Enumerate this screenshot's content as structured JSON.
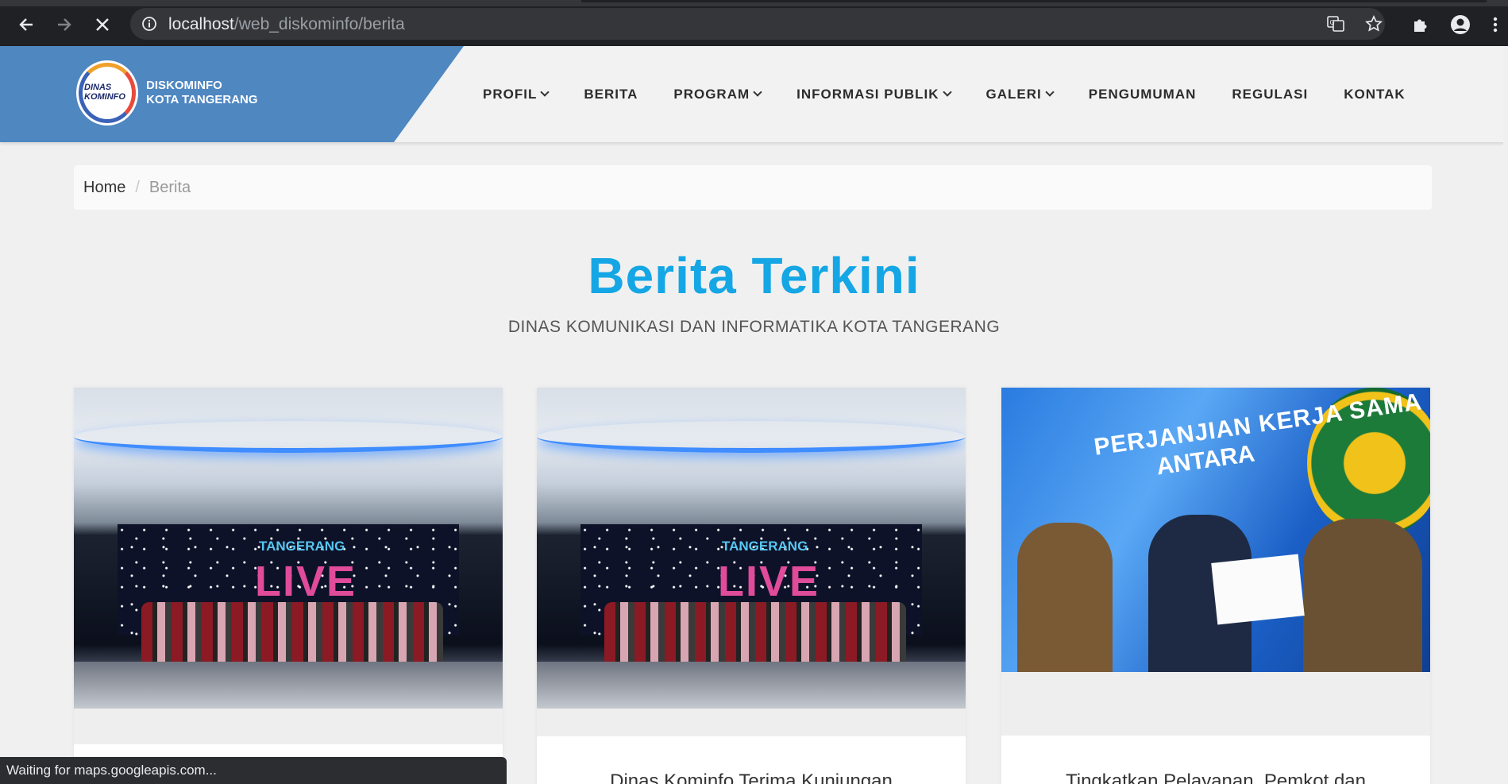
{
  "browser": {
    "url_host": "localhost",
    "url_path": "/web_diskominfo/berita",
    "status_text": "Waiting for maps.googleapis.com..."
  },
  "site": {
    "logo_text_line1": "DINAS",
    "logo_text_line2": "KOMINFO",
    "brand_line1": "DISKOMINFO",
    "brand_line2": "KOTA TANGERANG",
    "nav": [
      {
        "label": "PROFIL",
        "dropdown": true
      },
      {
        "label": "BERITA",
        "dropdown": false
      },
      {
        "label": "PROGRAM",
        "dropdown": true
      },
      {
        "label": "INFORMASI PUBLIK",
        "dropdown": true
      },
      {
        "label": "GALERI",
        "dropdown": true
      },
      {
        "label": "PENGUMUMAN",
        "dropdown": false
      },
      {
        "label": "REGULASI",
        "dropdown": false
      },
      {
        "label": "KONTAK",
        "dropdown": false
      }
    ]
  },
  "breadcrumb": {
    "home": "Home",
    "separator": "/",
    "current": "Berita"
  },
  "section": {
    "title": "Berita Terkini",
    "subtitle": "DINAS KOMUNIKASI DAN INFORMATIKA KOTA TANGERANG"
  },
  "cards": [
    {
      "image_text_top": "TANGERANG",
      "image_text_main": "LIVE",
      "title": ""
    },
    {
      "image_text_top": "TANGERANG",
      "image_text_main": "LIVE",
      "title": "Dinas Kominfo Terima Kunjungan"
    },
    {
      "image_text_line1": "PERJANJIAN KERJA SAMA",
      "image_text_line2": "ANTARA",
      "title": "Tingkatkan Pelayanan, Pemkot dan"
    }
  ],
  "colors": {
    "brand_blue": "#4f87c1",
    "title_blue": "#14a6e5",
    "chrome_dark": "#202124"
  }
}
